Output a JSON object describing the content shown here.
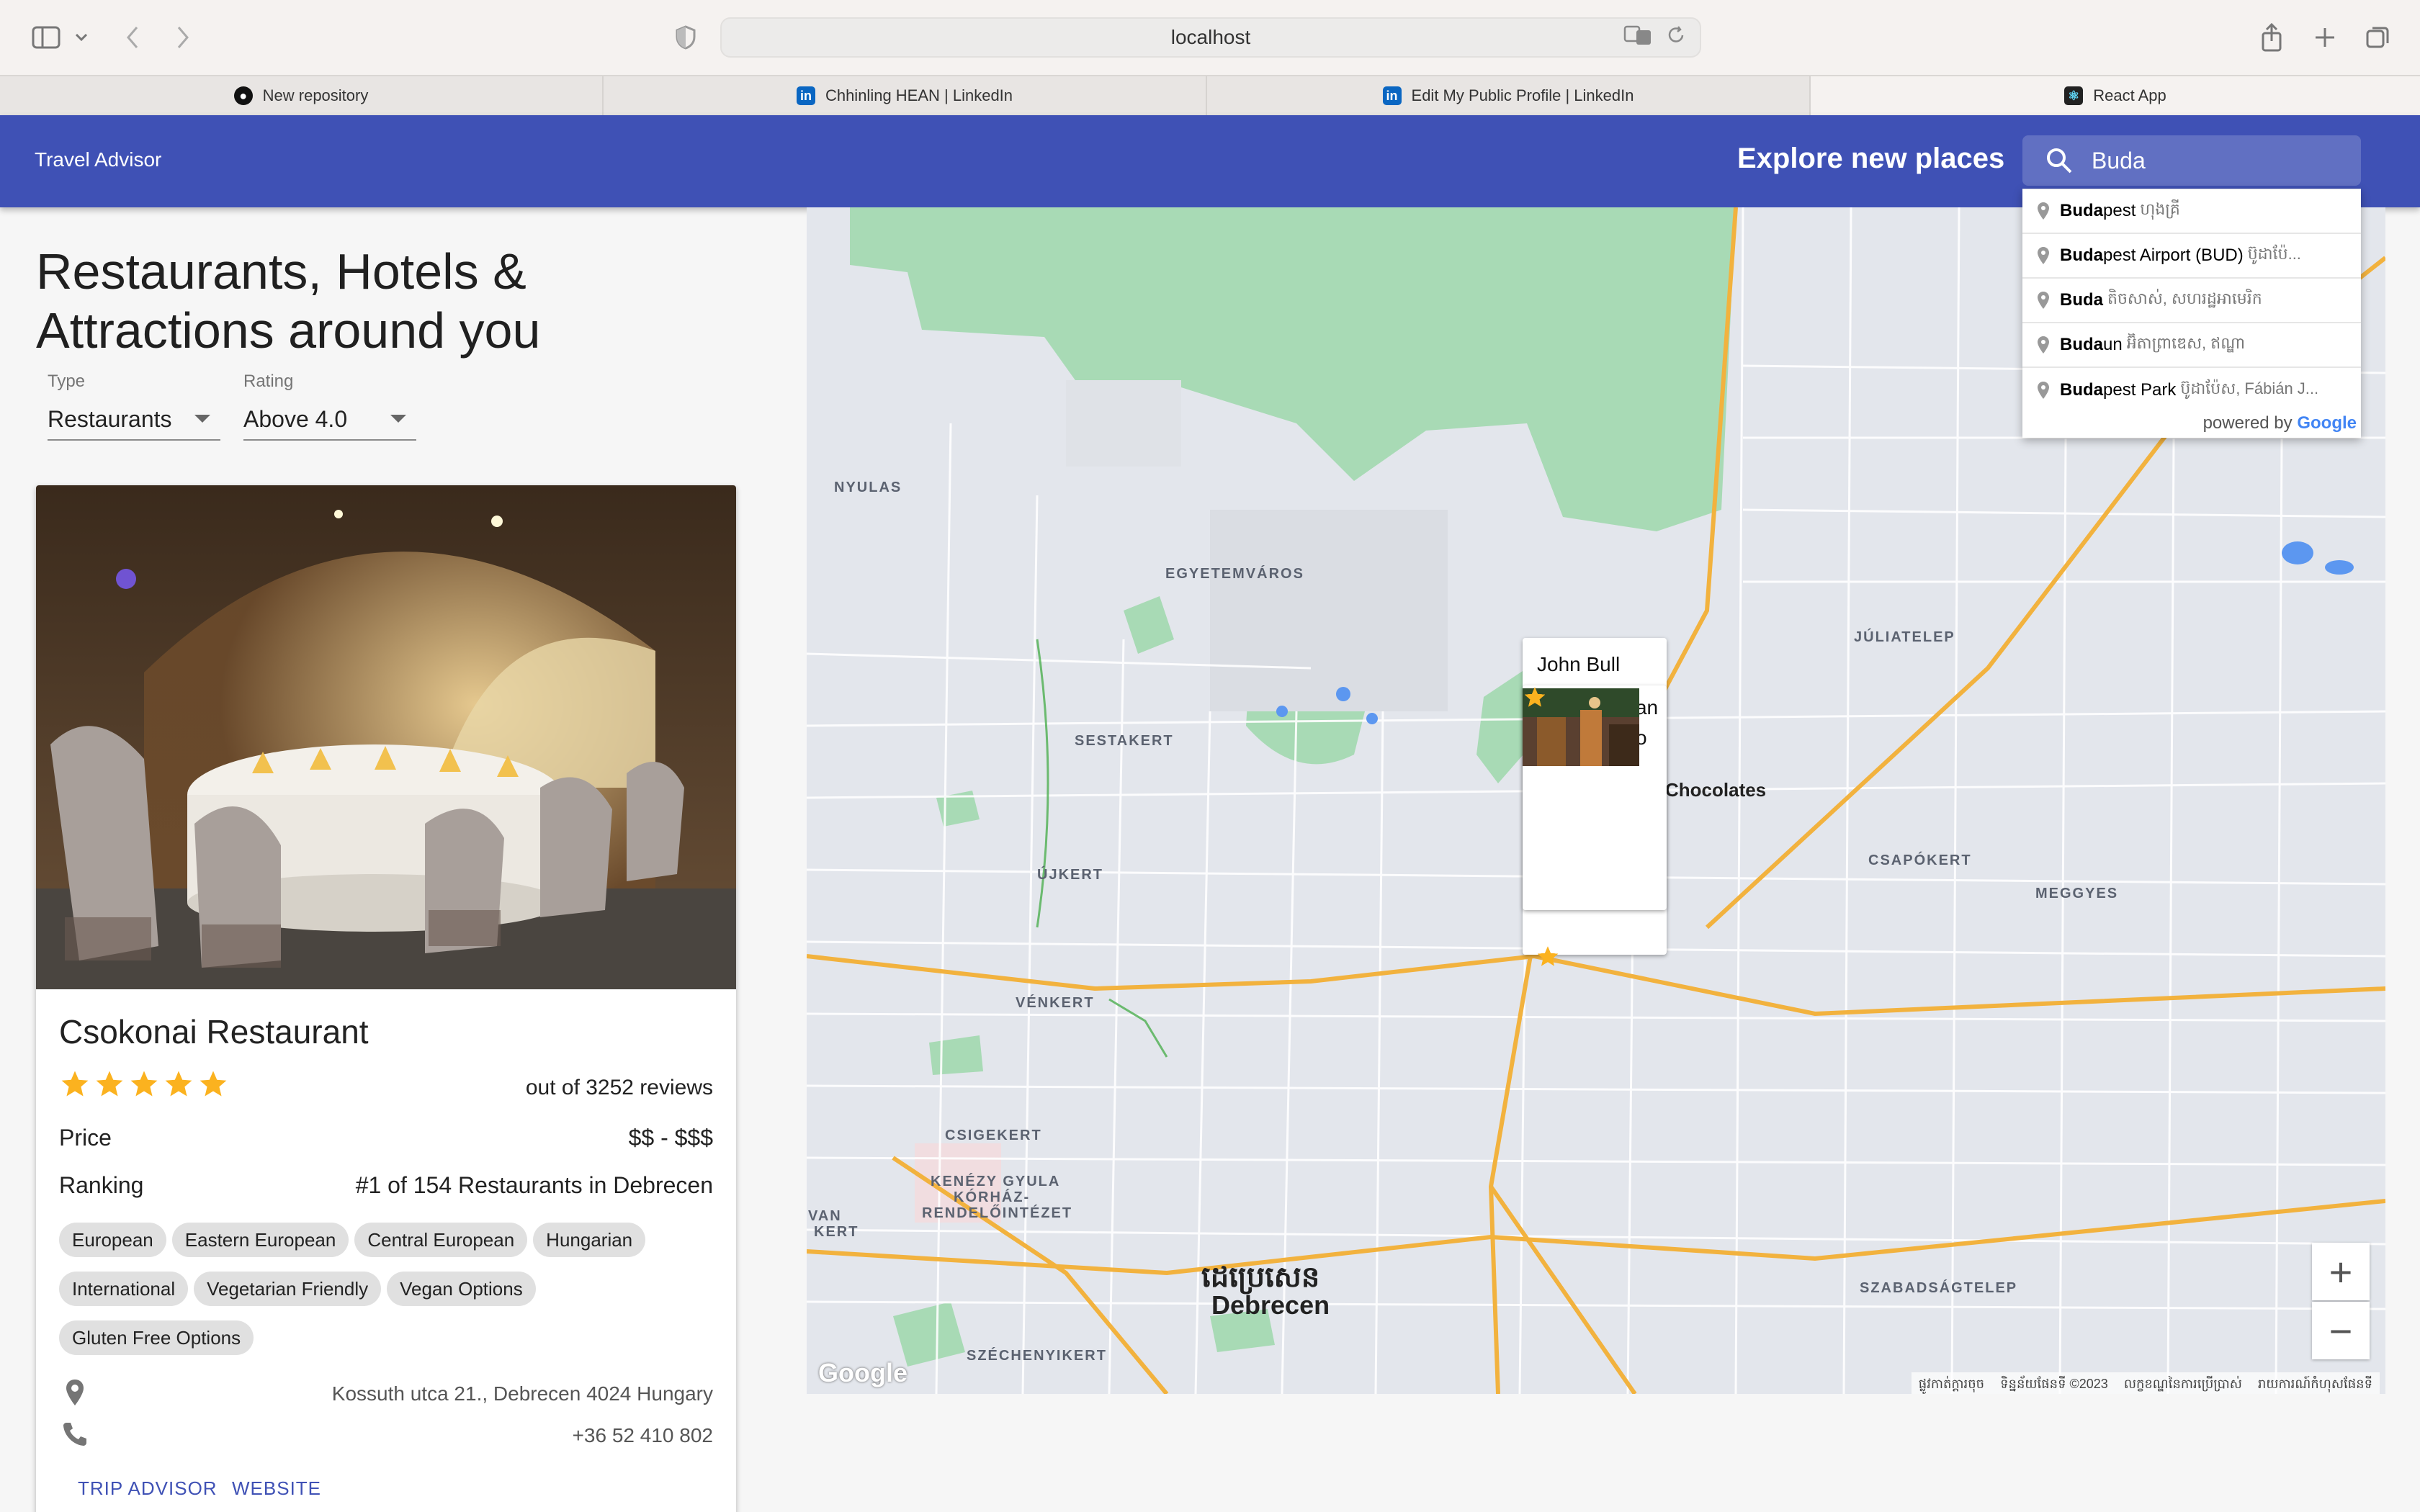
{
  "browser": {
    "url": "localhost",
    "tabs": [
      {
        "label": "New repository",
        "icon": "github-icon"
      },
      {
        "label": "Chhinling HEAN | LinkedIn",
        "icon": "linkedin-icon"
      },
      {
        "label": "Edit My Public Profile | LinkedIn",
        "icon": "linkedin-icon"
      },
      {
        "label": "React App",
        "icon": "react-icon"
      }
    ]
  },
  "header": {
    "title": "Travel Advisor",
    "explore": "Explore new places",
    "search_value": "Buda"
  },
  "autocomplete": {
    "items": [
      {
        "match": "Buda",
        "rest": "pest",
        "secondary": "ហុងគ្រី"
      },
      {
        "match": "Buda",
        "rest": "pest Airport (BUD)",
        "secondary": "ប៊ូដាប៉ែ..."
      },
      {
        "match": "Buda",
        "rest": "",
        "secondary": "តិចសាស់, សហរដ្ឋអាមេរិក"
      },
      {
        "match": "Buda",
        "rest": "un",
        "secondary": "អ៊ិតាព្រាឌេស, ឥណ្ឌា"
      },
      {
        "match": "Buda",
        "rest": "pest Park",
        "secondary": "ប៊ូដាប៉ែស, Fábián J..."
      }
    ],
    "powered_by": "powered by",
    "google": "Google"
  },
  "sidebar": {
    "title": "Restaurants, Hotels & Attractions around you",
    "type_label": "Type",
    "type_value": "Restaurants",
    "rating_label": "Rating",
    "rating_value": "Above 4.0"
  },
  "place": {
    "name": "Csokonai Restaurant",
    "rating": 5,
    "reviews": "out of 3252 reviews",
    "price_label": "Price",
    "price": "$$ - $$$",
    "ranking_label": "Ranking",
    "ranking": "#1 of 154 Restaurants in Debrecen",
    "cuisines": [
      "European",
      "Eastern European",
      "Central European",
      "Hungarian",
      "International",
      "Vegetarian Friendly",
      "Vegan Options",
      "Gluten Free Options"
    ],
    "address": "Kossuth utca 21., Debrecen 4024 Hungary",
    "phone": "+36 52 410 802",
    "btn_trip": "TRIP ADVISOR",
    "btn_web": "WEBSITE"
  },
  "map": {
    "labels": {
      "nyulas": "NYULAS",
      "egyetemvaros": "EGYETEMVÁROS",
      "juliatelep": "JÚLIATELEP",
      "sestakert": "SESTAKERT",
      "ujkert": "ÚJKERT",
      "csapokert": "CSAPÓKERT",
      "meggyes": "MEGGYES",
      "venkert": "VÉNKERT",
      "csigekert": "CSIGEKERT",
      "kenezy1": "KENÉZY GYULA",
      "kenezy2": "KÓRHÁZ-",
      "kenezy3": "RENDELŐINTÉZET",
      "van": "VAN",
      "kert": "KERT",
      "szabadsagtelep": "SZABADSÁGTELEP",
      "szechenyikert": "SZÉCHENYIKERT",
      "city_khmer": "ដេប្រេសេន",
      "city": "Debrecen",
      "chocolates": "Chocolates"
    },
    "popup_back_title": "John Bull",
    "popup_title": "Kis Padlizsan vegan bistro",
    "popup_rating": 5,
    "footer": [
      "ផ្លូវកាត់ក្ដារចុច",
      "ទិន្នន័យផែនទី ©2023",
      "លក្ខខណ្ឌនៃការប្រើប្រាស់",
      "រាយការណ៍កំហុសផែនទី"
    ],
    "google": "Google",
    "zoom_in": "+",
    "zoom_out": "−"
  },
  "colors": {
    "appbar": "#3f51b5",
    "star": "#fbb21f",
    "park": "#a8dab5",
    "road_major": "#f2b23e"
  }
}
